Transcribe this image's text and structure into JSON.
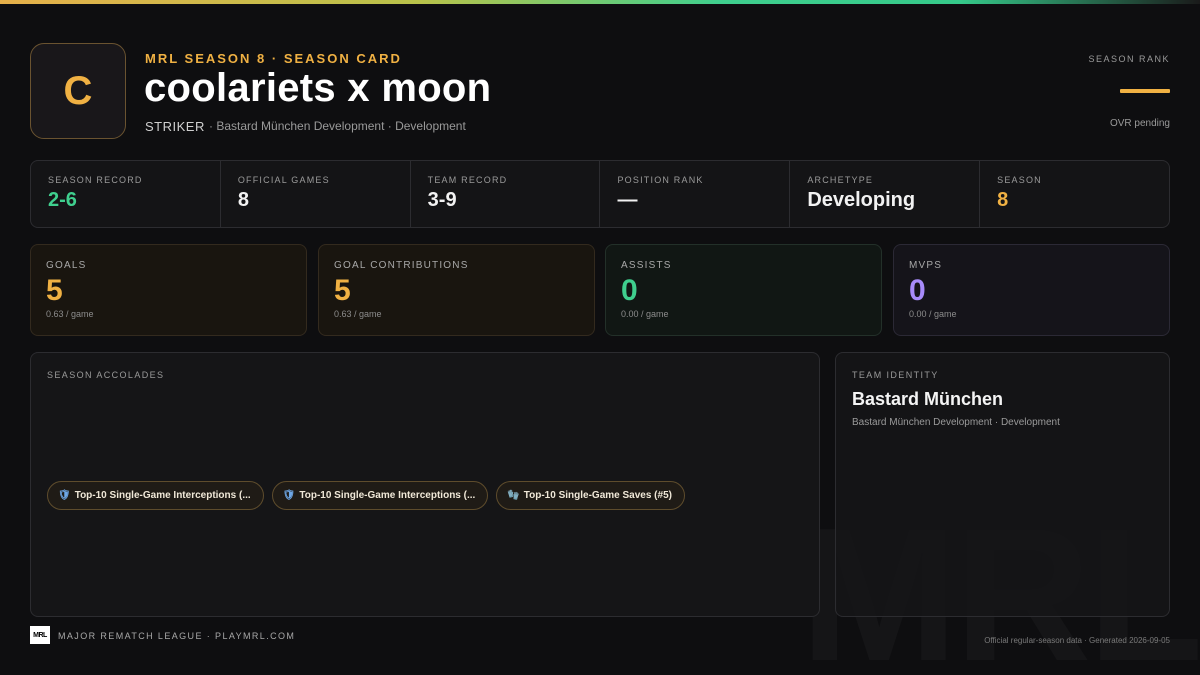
{
  "header": {
    "avatar_letter": "C",
    "eyebrow": "MRL SEASON 8 · SEASON CARD",
    "player_name": "coolariets x moon",
    "position": "STRIKER",
    "team_line": "· Bastard München Development · Development",
    "rank_label": "SEASON RANK",
    "rank_note": "OVR pending"
  },
  "summary": [
    {
      "label": "SEASON RECORD",
      "value": "2-6"
    },
    {
      "label": "OFFICIAL GAMES",
      "value": "8"
    },
    {
      "label": "TEAM RECORD",
      "value": "3-9"
    },
    {
      "label": "POSITION RANK",
      "value": "—"
    },
    {
      "label": "ARCHETYPE",
      "value": "Developing"
    },
    {
      "label": "SEASON",
      "value": "8"
    }
  ],
  "stats": [
    {
      "label": "GOALS",
      "value": "5",
      "sub": "0.63 / game"
    },
    {
      "label": "GOAL CONTRIBUTIONS",
      "value": "5",
      "sub": "0.63 / game"
    },
    {
      "label": "ASSISTS",
      "value": "0",
      "sub": "0.00 / game"
    },
    {
      "label": "MVPS",
      "value": "0",
      "sub": "0.00 / game"
    }
  ],
  "accolades": {
    "label": "SEASON ACCOLADES",
    "items": [
      {
        "icon": "🛡",
        "text": "Top-10 Single-Game Interceptions (..."
      },
      {
        "icon": "🛡",
        "text": "Top-10 Single-Game Interceptions (..."
      },
      {
        "icon": "🧤",
        "text": "Top-10 Single-Game Saves (#5)"
      }
    ]
  },
  "team": {
    "label": "TEAM IDENTITY",
    "name": "Bastard München",
    "sub": "Bastard München Development · Development"
  },
  "footer": {
    "logo": "MRL",
    "left": "MAJOR REMATCH LEAGUE · PLAYMRL.COM",
    "right": "Official regular-season data · Generated 2026-09-05"
  },
  "watermark": "MRL",
  "colors": {
    "accent_gold": "#f0b143",
    "accent_green": "#3fcf8e",
    "accent_purple": "#a78bfa",
    "background": "#0e0e10"
  }
}
